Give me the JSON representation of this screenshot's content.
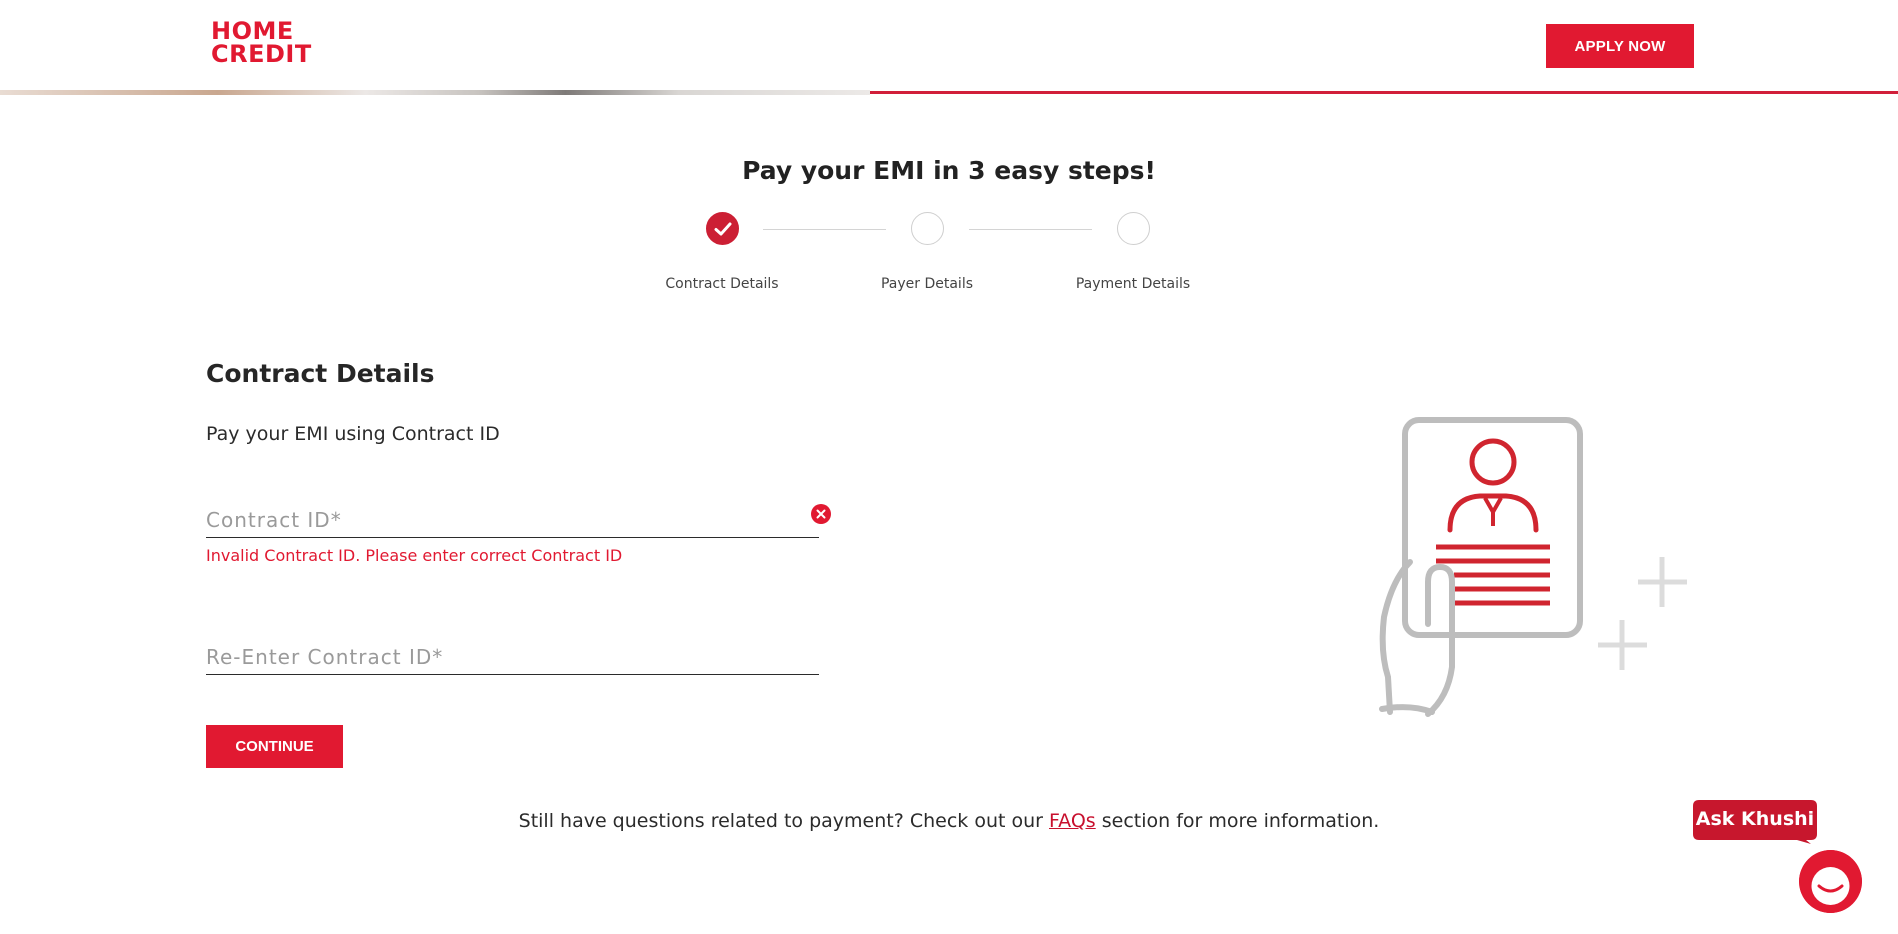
{
  "header": {
    "logo_line1": "HOME",
    "logo_line2": "CREDIT",
    "apply_label": "APPLY NOW"
  },
  "steps": {
    "title": "Pay your EMI in 3 easy steps!",
    "items": [
      {
        "label": "Contract Details",
        "done": true
      },
      {
        "label": "Payer Details",
        "done": false
      },
      {
        "label": "Payment Details",
        "done": false
      }
    ]
  },
  "form": {
    "section_title": "Contract Details",
    "subtitle": "Pay your EMI using Contract ID",
    "contract_id": {
      "placeholder": "Contract ID*",
      "value": ""
    },
    "error_message": "Invalid Contract ID. Please enter correct Contract ID",
    "reenter_contract_id": {
      "placeholder": "Re-Enter Contract ID*",
      "value": ""
    },
    "continue_label": "CONTINUE"
  },
  "footer": {
    "faq_prefix": "Still have questions related to payment? Check out our ",
    "faq_link": "FAQs",
    "faq_suffix": " section for more information."
  },
  "chat": {
    "label": "Ask Khushi"
  },
  "colors": {
    "brand_red": "#e11931",
    "link_red": "#c8102e",
    "illustration_red": "#d0252f",
    "illustration_gray": "#bdbdbd"
  },
  "icons": {
    "step_done": "check-icon",
    "field_error": "error-x-icon",
    "chat": "chat-icon"
  }
}
